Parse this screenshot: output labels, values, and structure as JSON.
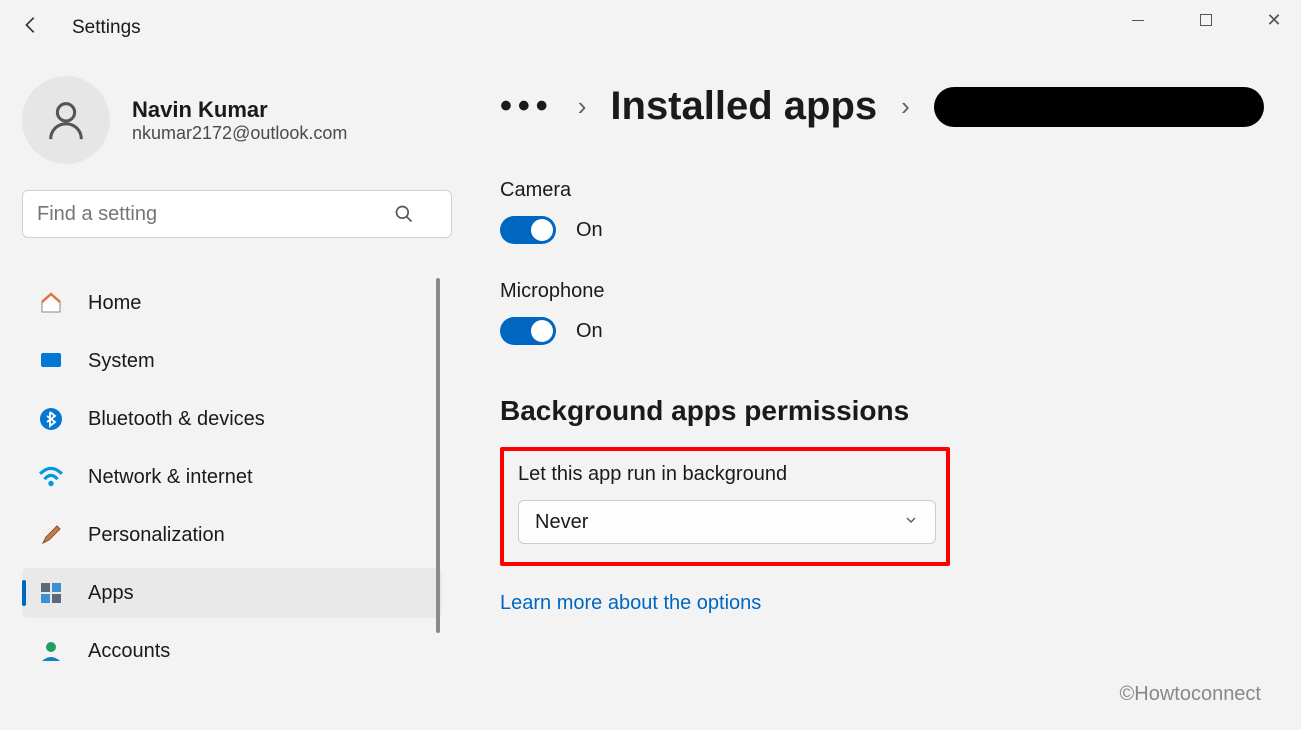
{
  "window": {
    "title": "Settings"
  },
  "profile": {
    "name": "Navin Kumar",
    "email": "nkumar2172@outlook.com"
  },
  "search": {
    "placeholder": "Find a setting"
  },
  "sidebar": {
    "items": [
      {
        "label": "Home",
        "icon": "home-icon",
        "active": false
      },
      {
        "label": "System",
        "icon": "system-icon",
        "active": false
      },
      {
        "label": "Bluetooth & devices",
        "icon": "bluetooth-icon",
        "active": false
      },
      {
        "label": "Network & internet",
        "icon": "wifi-icon",
        "active": false
      },
      {
        "label": "Personalization",
        "icon": "brush-icon",
        "active": false
      },
      {
        "label": "Apps",
        "icon": "apps-icon",
        "active": true
      },
      {
        "label": "Accounts",
        "icon": "accounts-icon",
        "active": false
      }
    ]
  },
  "breadcrumb": {
    "overflow": "…",
    "parent": "Installed apps",
    "current_redacted": true
  },
  "permissions": {
    "camera": {
      "label": "Camera",
      "state": "On",
      "on": true
    },
    "microphone": {
      "label": "Microphone",
      "state": "On",
      "on": true
    }
  },
  "background_section": {
    "title": "Background apps permissions",
    "label": "Let this app run in background",
    "selected": "Never",
    "learn_more": "Learn more about the options"
  },
  "watermark": "©Howtoconnect"
}
